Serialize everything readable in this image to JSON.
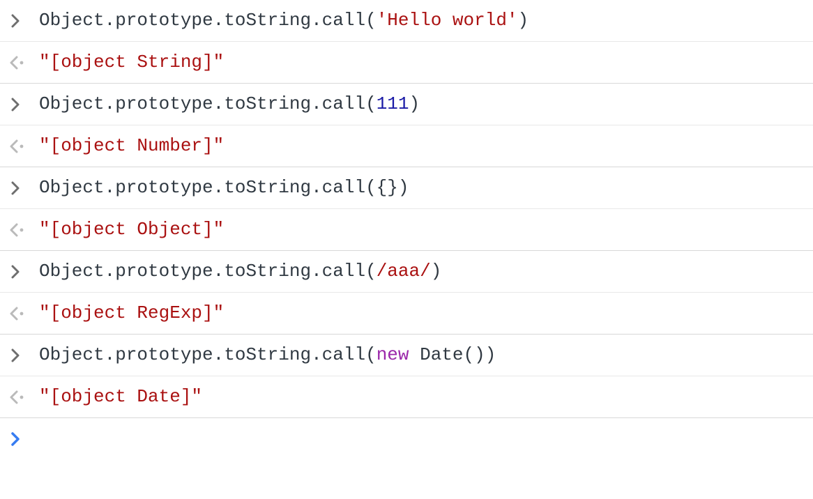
{
  "colors": {
    "default": "#303942",
    "string": "#aa1111",
    "number": "#1a1aa6",
    "regex": "#aa1111",
    "keyword": "#9b28aa",
    "result": "#aa1111",
    "promptArrow": "#367cf1",
    "inputArrow": "#6e6e6e",
    "outputArrow": "#9e9e9e",
    "outputDot": "#b8b8b8"
  },
  "entries": [
    {
      "inputTokens": [
        {
          "t": "Object.prototype.toString.call(",
          "c": "default"
        },
        {
          "t": "'Hello world'",
          "c": "string"
        },
        {
          "t": ")",
          "c": "default"
        }
      ],
      "output": "\"[object String]\""
    },
    {
      "inputTokens": [
        {
          "t": "Object.prototype.toString.call(",
          "c": "default"
        },
        {
          "t": "111",
          "c": "number"
        },
        {
          "t": ")",
          "c": "default"
        }
      ],
      "output": "\"[object Number]\""
    },
    {
      "inputTokens": [
        {
          "t": "Object.prototype.toString.call({})",
          "c": "default"
        }
      ],
      "output": "\"[object Object]\""
    },
    {
      "inputTokens": [
        {
          "t": "Object.prototype.toString.call(",
          "c": "default"
        },
        {
          "t": "/aaa/",
          "c": "regex"
        },
        {
          "t": ")",
          "c": "default"
        }
      ],
      "output": "\"[object RegExp]\""
    },
    {
      "inputTokens": [
        {
          "t": "Object.prototype.toString.call(",
          "c": "default"
        },
        {
          "t": "new",
          "c": "keyword"
        },
        {
          "t": " Date())",
          "c": "default"
        }
      ],
      "output": "\"[object Date]\""
    }
  ],
  "prompt": {
    "value": ""
  }
}
